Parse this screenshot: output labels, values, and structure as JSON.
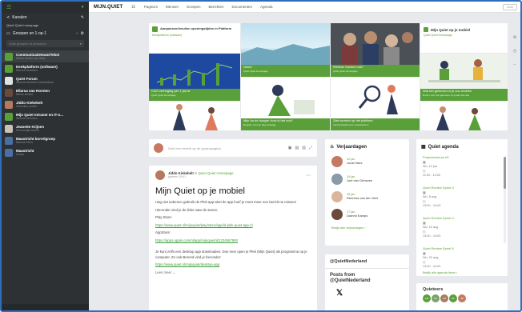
{
  "sidebar": {
    "kanalen": "Kanalen",
    "current_channel": "Quiet Quiet homepage",
    "groepen": "Groepen en 1-op-1",
    "search_placeholder": "Zoek groepen of personen",
    "items": [
      {
        "title": "Communicatieteam/Tekst",
        "sub": "Nieuw bericht van Jiddo",
        "color": "#5aa03a"
      },
      {
        "title": "Denkplatform (software)",
        "sub": "Nieuwe berichten",
        "color": "#5aa03a"
      },
      {
        "title": "Quiet Forum",
        "sub": "Nieuwe berichten beschikbaar",
        "color": "#dfe3e6"
      },
      {
        "title": "Ellarsa van Horsten",
        "sub": "Nieuw bericht",
        "color": "#6b4a3a"
      },
      {
        "title": "Jiddo Kiekebelt",
        "sub": "Gebruiker profiel",
        "color": "#b57a5e"
      },
      {
        "title": "Mijn Quiet Intranet en IT-o...",
        "sub": "Nieuwe berichten",
        "color": "#5aa03a"
      },
      {
        "title": "Jeanette Krijnen",
        "sub": "Persoonlijk bericht",
        "color": "#c9c2b8"
      },
      {
        "title": "Maastricht borrelgroep",
        "sub": "Nieuwe foto's",
        "color": "#4a6fa5"
      },
      {
        "title": "Maastricht",
        "sub": "Groep",
        "color": "#4a6fa5"
      }
    ]
  },
  "topbar": {
    "logo": "MIJN.QUIET",
    "nav": [
      "Pagina's",
      "Mensen",
      "Groepen",
      "Berichten",
      "Documenten",
      "Agenda"
    ],
    "right": "Zoek"
  },
  "tiles": {
    "t1_title": "Aanpassen/invullen openingstijden in Platform",
    "t1_sub": "Denkplatform (software)",
    "t2_title": "Ulend",
    "t2_sub": "Quiet Quiet Homepage",
    "t3_title": "Welkom bovens ook?",
    "t3_sub": "Quiet Quiet Homepage",
    "t4_title": "Mijn Quiet op je mobiel",
    "t4_sub": "Quiet Quiet Homepage",
    "t5_title": "CAO verhoging per 1 jan ar",
    "t5_sub": "Quiet Quiet Homepage",
    "t6_title": "Wat het gebeurd en je zou moeten",
    "t6_sub": "Rozen voor het gebeuren zo je aan iets wat",
    "t7_title": "Mijn ha de hoogte: how is het ook?",
    "t7_sub": "Regelen voor de dag vandaag",
    "t8_title": "Ziek worden op het platform",
    "t8_sub": "Verzuimbeleid voor medewerkers"
  },
  "post_box": {
    "placeholder": "Deel een bericht op de groepspagina"
  },
  "feed": {
    "author": "Jiddo Kiekebelt",
    "in": "in",
    "group": "Quiet Quiet Homepage",
    "date": "gisteren 15:01",
    "title": "Mijn Quiet op je mobiel",
    "p1": "Hag niet iedereen gebruik de Plek app alert de app hoef je moet meer een bericht te missen!",
    "p2": "Hieronder vind je de links naar de stores:",
    "playstore": "Play Store:",
    "link1": "https://www.quiet.nl/mijnquiet/play/store/app/id-plek-quiet-app-nl",
    "appstore": "AppStore:",
    "link2": "https://apps.apple.com/nl/app/mijnquiet/id1234567890",
    "p3": "Je kunt zelfs een desktop app downloaden. Doe mee open je Plek (Mijn Quiet) als programma op je computer. Zo ook Berend vind je hieronder:",
    "link3": "https://www.quiet.nl/mijnquiet/desktop-app",
    "more": "Lees meer"
  },
  "birthdays": {
    "title": "Verjaardagen",
    "list": [
      {
        "date": "12 jan",
        "name": "Joost Vaes"
      },
      {
        "date": "14 jan",
        "name": "Joel van Grinsven"
      },
      {
        "date": "16 jan",
        "name": "Rennera van der Veld"
      },
      {
        "date": "17 jan",
        "name": "Dammi Kamps"
      }
    ],
    "more": "Bekijk alle verjaardagen"
  },
  "agenda": {
    "title": "Quiet agenda",
    "items": [
      {
        "title": "Projectenbeurs #3",
        "date": "Wo, 12 jan",
        "time": "11:00 - 12:00"
      },
      {
        "title": "Quiet Review Sprint 3",
        "date": "Wo, 8 aug",
        "time": "13:00 - 14:00"
      },
      {
        "title": "Quiet Review Sprint 4",
        "date": "Wo, 15 aug",
        "time": "13:00 - 14:00"
      },
      {
        "title": "Quiet Review Sprint 5",
        "date": "Wo, 22 aug",
        "time": "13:00 - 14:00"
      }
    ],
    "more": "Bekijk alle agenda items"
  },
  "twitter": {
    "handle": "@QuietNederland",
    "posts_from": "Posts from",
    "posts_handle": "@QuietNederland"
  },
  "quieteers": {
    "title": "Quieteers",
    "avatars": [
      "AM",
      "KV",
      "AN",
      "AF",
      "JD"
    ]
  }
}
